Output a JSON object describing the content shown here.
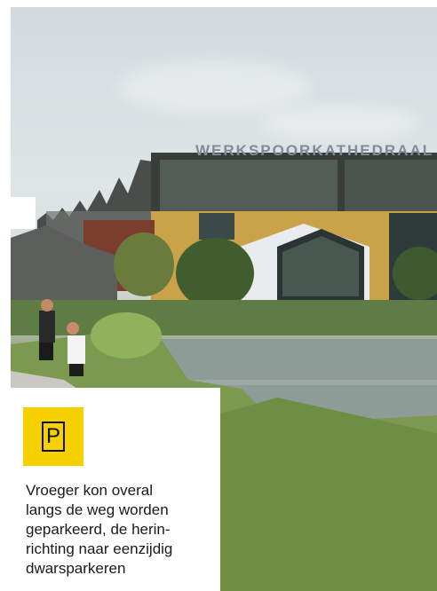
{
  "photo": {
    "building_sign": "WERKSPOORKATHEDRAAL"
  },
  "card": {
    "badge_letter": "P",
    "lines": [
      "Vroeger kon overal",
      "langs de weg worden",
      "geparkeerd, de herin-",
      "richting naar eenzijdig",
      "dwarsparkeren"
    ]
  },
  "colors": {
    "badge": "#f7d000",
    "text": "#1a1a1a"
  }
}
